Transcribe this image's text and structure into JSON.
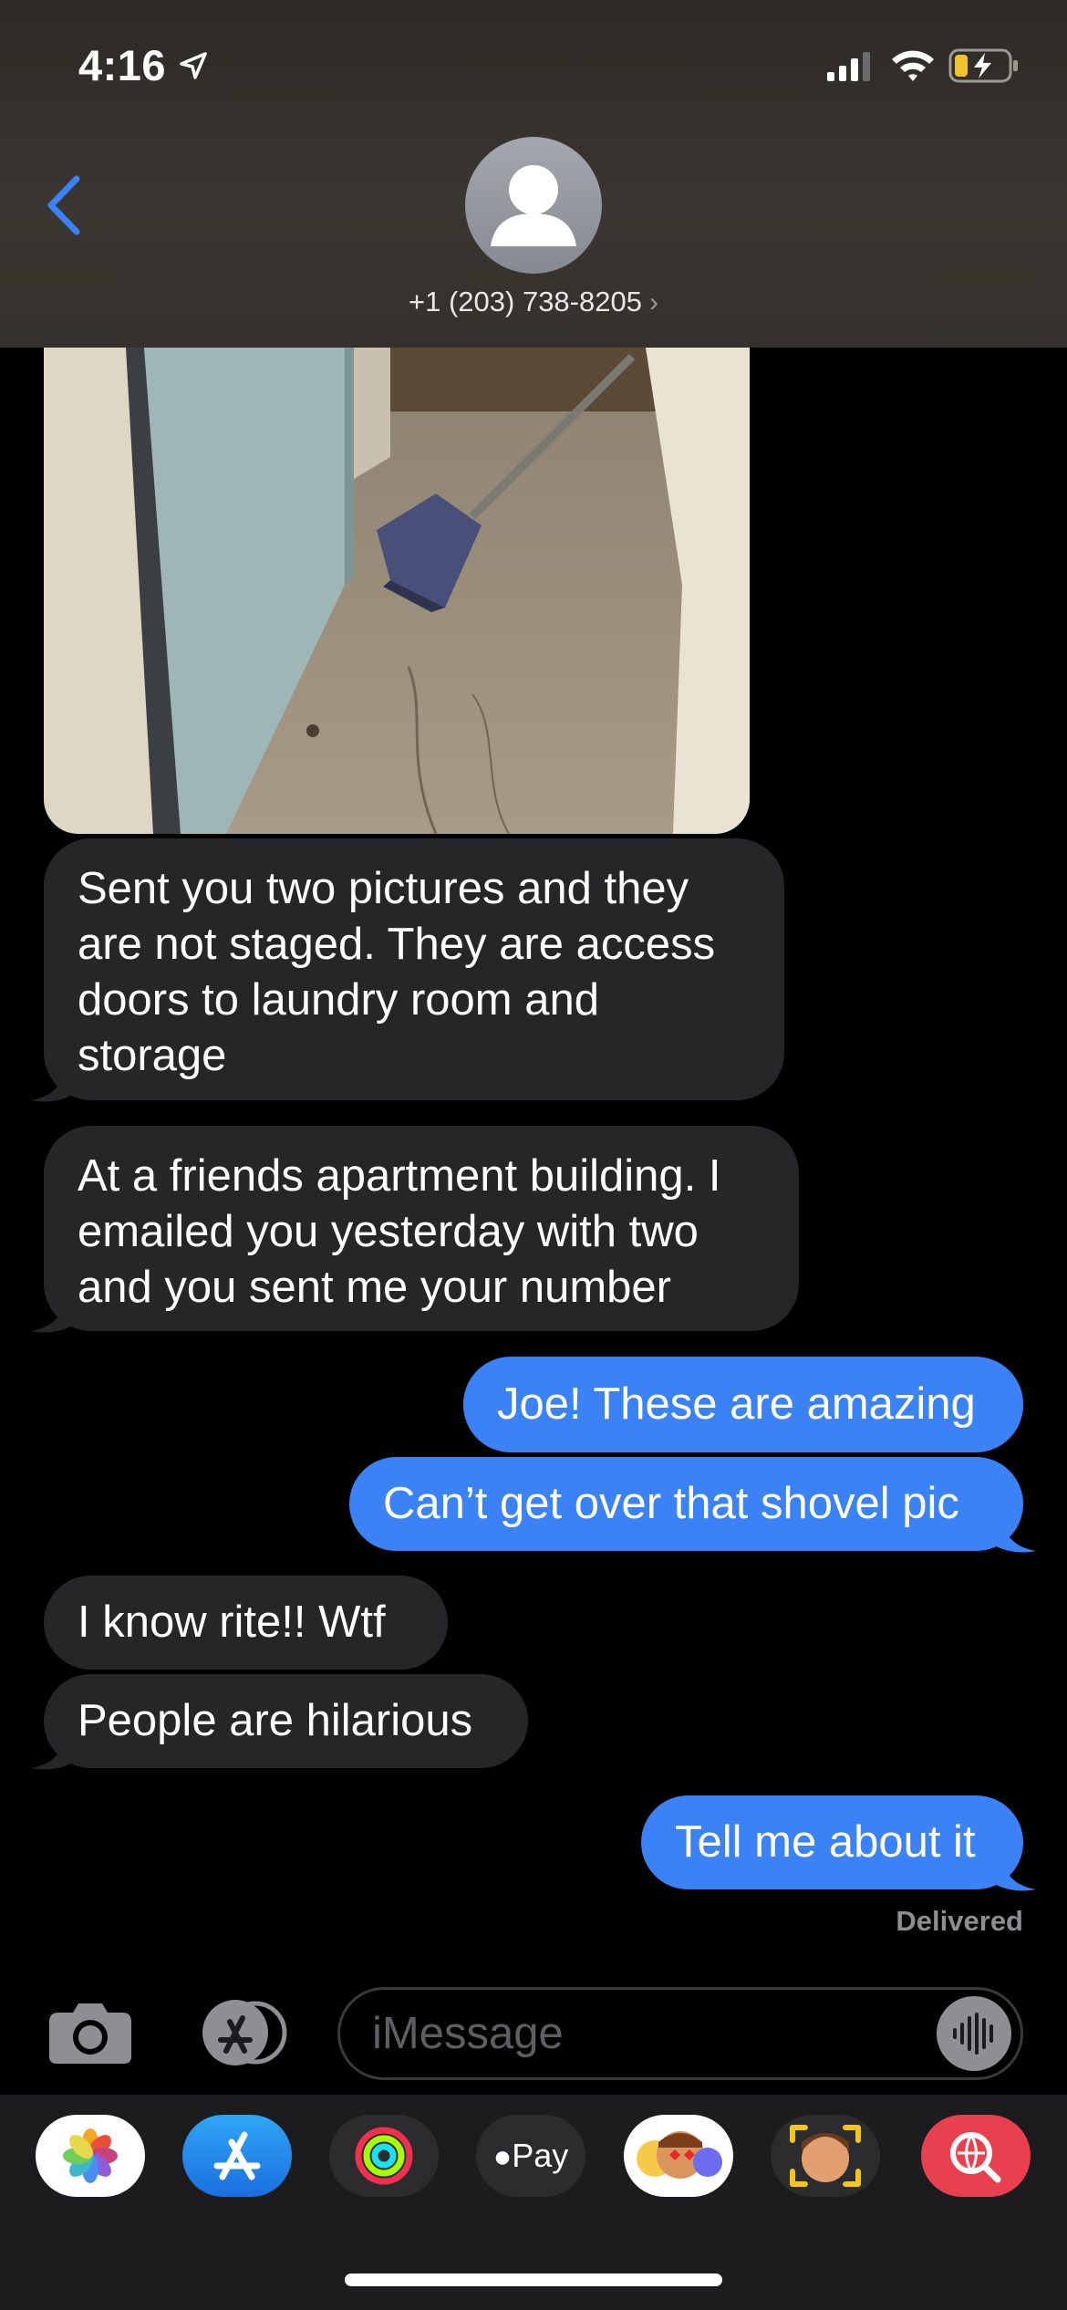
{
  "status_bar": {
    "time": "4:16"
  },
  "contact": {
    "name": "+1 (203) 738-8205",
    "chevron": "›"
  },
  "messages": [
    {
      "from": "them",
      "text": "Sent you two pictures and they\nare not staged. They are access\ndoors to laundry room and\nstorage"
    },
    {
      "from": "them",
      "text": "At a friends apartment building. I\nemailed you yesterday with two\nand you sent me your number"
    },
    {
      "from": "me",
      "text": "Joe! These are amazing"
    },
    {
      "from": "me",
      "text": "Can’t get over that shovel pic"
    },
    {
      "from": "them",
      "text": "I know rite!! Wtf"
    },
    {
      "from": "them",
      "text": "People are hilarious"
    },
    {
      "from": "me",
      "text": "Tell me about it"
    }
  ],
  "delivered_label": "Delivered",
  "input": {
    "placeholder": "iMessage"
  },
  "apps": [
    {
      "name": "photos-icon"
    },
    {
      "name": "app-store-icon"
    },
    {
      "name": "activity-icon"
    },
    {
      "name": "apple-pay-icon",
      "label": "Pay"
    },
    {
      "name": "animoji-icon"
    },
    {
      "name": "memoji-icon"
    },
    {
      "name": "web-search-icon"
    }
  ],
  "colors": {
    "sent_bubble": "#3b82f6",
    "received_bubble": "#262628",
    "accent": "#3b82f6"
  }
}
